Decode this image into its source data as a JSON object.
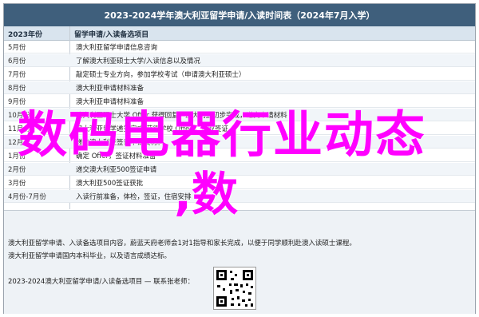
{
  "title": "2023-2024学年澳大利亚留学申请/入读时间表（2024年7月入学）",
  "header": {
    "col1": "2023年份",
    "col2": "留学申请/入读备选项目"
  },
  "rows": [
    {
      "month": "5月份",
      "text": "澳大利亚留学申请信息咨询"
    },
    {
      "month": "6月份",
      "text": "了解澳大利亚硕士大学/入读信息以及情况"
    },
    {
      "month": "7月份",
      "text": "敲定硕士专业方向，参加学校考试（申请澳大利亚硕士）"
    },
    {
      "month": "8月份",
      "text": "澳大利亚申请材料准备"
    },
    {
      "month": "9月份",
      "text": "澳大利亚申请材料准备"
    },
    {
      "month": "10月份",
      "text": "澳大利亚硕士大学 Offer 获得回复，澳大利亚初步完成，递交申请材料"
    },
    {
      "month": "11月份",
      "text": "澳大利亚留学递签完成 获得学校 Offer ，获取签证"
    },
    {
      "month": "12月份",
      "text": "递交澳大利亚签证申请及材料"
    },
    {
      "month": "1月份",
      "text": "确定 Offer，签证材料准备"
    },
    {
      "month": "2月份",
      "text": "递交澳大利亚500签证申请"
    },
    {
      "month": "3月份",
      "text": "澳大利亚500签证获批"
    },
    {
      "month": "4月份-7月份",
      "text": "入读行前准备，体检，签证，住宿安排"
    }
  ],
  "footer": {
    "line1": "澳大利亚留学申请、入读备选项目内容，蔚蓝天府老师会1对1指导和家长完成，以便于同学顺利赴澳入读硕士课程。",
    "line2": "澳大利亚留学申请国内本科毕业，以及语言成绩达标。",
    "line3": "2023-2024澳大利亚留学申请/入读备选项目 — 联系张老师："
  },
  "overlay": {
    "line1": "数码电器行业动态",
    "line2": ",数"
  },
  "colors": {
    "title_bg": "#3f5f7c",
    "overlay": "#ff00ff"
  },
  "icons": {
    "qr": "qr-code-icon"
  }
}
